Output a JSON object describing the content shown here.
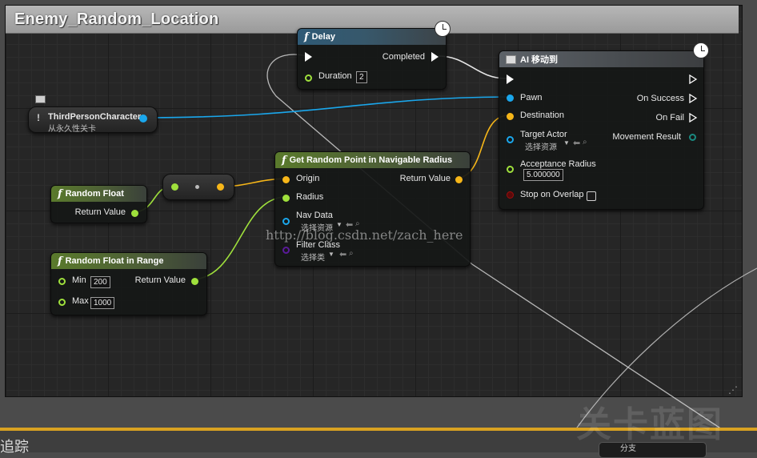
{
  "graph": {
    "title": "Enemy_Random_Location",
    "watermark_url": "http://blog.csdn.net/zach_here",
    "watermark_big": "关卡蓝图",
    "bottom_tab_label": "追踪",
    "corner_node_label": "分支"
  },
  "colors": {
    "object_pin": "#1aa7ec",
    "vector_pin": "#f6b619",
    "float_pin": "#9fe03c",
    "class_pin": "#5a1a9a",
    "bool_pin": "#9e0d0d",
    "exec_pin": "#ffffff",
    "accent": "#d9a221"
  },
  "nodes": {
    "delay": {
      "title": "Delay",
      "completed": "Completed",
      "duration_label": "Duration",
      "duration_value": "2"
    },
    "ai_move_to": {
      "title": "AI 移动到",
      "pawn": "Pawn",
      "destination": "Destination",
      "target_actor": "Target Actor",
      "target_actor_select": "选择资源",
      "acceptance_radius": "Acceptance Radius",
      "acceptance_value": "5.000000",
      "stop_on_overlap": "Stop on Overlap",
      "on_success": "On Success",
      "on_fail": "On Fail",
      "movement_result": "Movement Result"
    },
    "third_person": {
      "name": "ThirdPersonCharacter",
      "subtitle": "从永久性关卡"
    },
    "get_random_point": {
      "title": "Get Random Point in Navigable Radius",
      "origin": "Origin",
      "radius": "Radius",
      "nav_data": "Nav Data",
      "nav_data_select": "选择资源",
      "filter_class": "Filter Class",
      "filter_class_select": "选择类",
      "return_value": "Return Value"
    },
    "random_float": {
      "title": "Random Float",
      "return_value": "Return Value"
    },
    "random_float_in_range": {
      "title": "Random Float in Range",
      "min_label": "Min",
      "min_value": "200",
      "max_label": "Max",
      "max_value": "1000",
      "return_value": "Return Value"
    }
  }
}
